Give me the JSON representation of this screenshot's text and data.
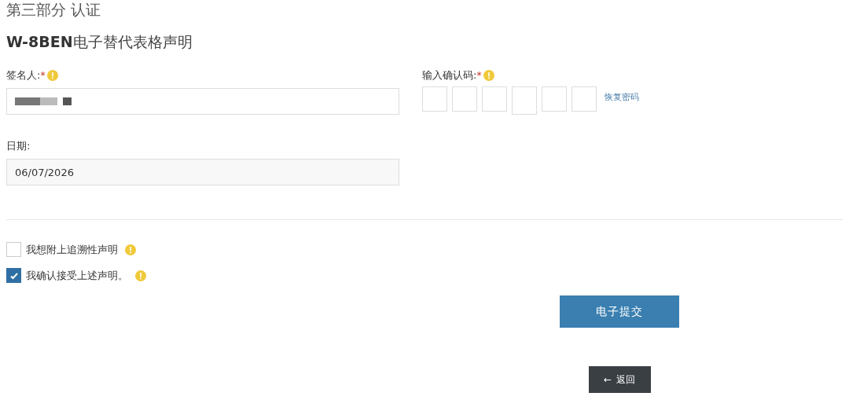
{
  "section_title": "第三部分 认证",
  "form_title": "**W-8BEN**电子替代表格声明",
  "signer": {
    "label": "签名人:",
    "required_mark": "*",
    "value_redacted": true
  },
  "code": {
    "label": "输入确认码:",
    "required_mark": "*",
    "boxes": [
      {
        "focused": false
      },
      {
        "focused": false
      },
      {
        "focused": false
      },
      {
        "focused": true
      },
      {
        "focused": false
      },
      {
        "focused": false
      }
    ],
    "link": "恢复密码"
  },
  "date": {
    "label": "日期:",
    "value": "06/07/2026"
  },
  "checkboxes": [
    {
      "label": "我想附上追溯性声明",
      "checked": false
    },
    {
      "label": "我确认接受上述声明。",
      "checked": true
    }
  ],
  "submit_button": "电子提交",
  "back_button": {
    "icon": "←",
    "label": "返回"
  }
}
